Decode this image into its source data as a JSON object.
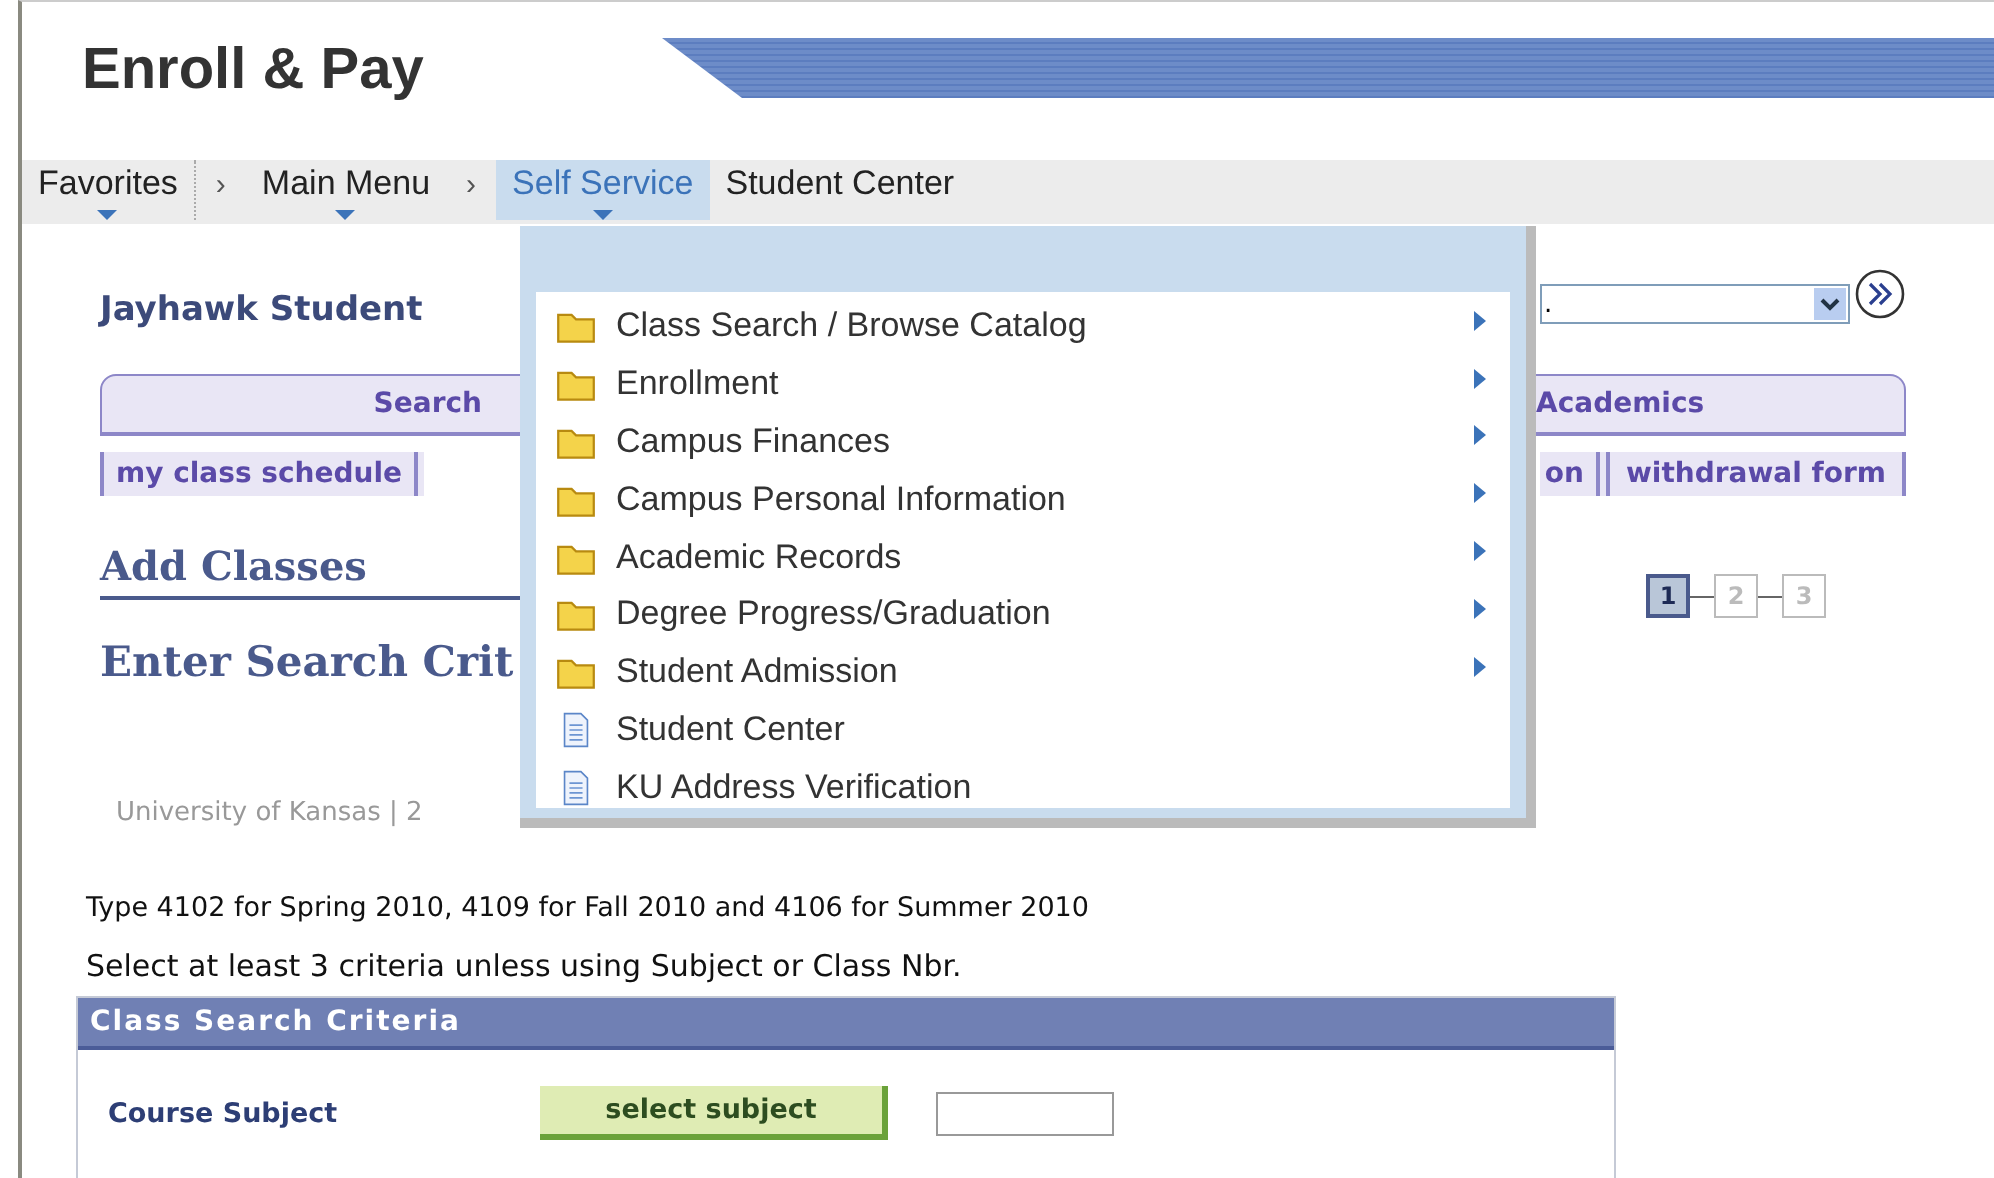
{
  "header": {
    "title": "Enroll & Pay"
  },
  "breadcrumbs": [
    {
      "label": "Favorites",
      "kind": "menu",
      "selected": false
    },
    {
      "label": "Main Menu",
      "kind": "menu",
      "selected": false,
      "separator": "›"
    },
    {
      "label": "Self Service",
      "kind": "menu",
      "selected": true,
      "separator": "›"
    },
    {
      "label": "Student Center",
      "kind": "page",
      "selected": false
    }
  ],
  "dropdown": [
    {
      "label": "Class Search / Browse Catalog",
      "kind": "folder",
      "submenu": true
    },
    {
      "label": "Enrollment",
      "kind": "folder",
      "submenu": true
    },
    {
      "label": "Campus Finances",
      "kind": "folder",
      "submenu": true
    },
    {
      "label": "Campus Personal Information",
      "kind": "folder",
      "submenu": true
    },
    {
      "label": "Academic Records",
      "kind": "folder",
      "submenu": true
    },
    {
      "label": "Degree Progress/Graduation",
      "kind": "folder",
      "submenu": true
    },
    {
      "label": "Student Admission",
      "kind": "folder",
      "submenu": true
    },
    {
      "label": "Student Center",
      "kind": "page",
      "submenu": false
    },
    {
      "label": "KU Address Verification",
      "kind": "page",
      "submenu": false
    }
  ],
  "student": {
    "name": "Jayhawk Student",
    "select_value": ".",
    "tabs": [
      {
        "label": "Search",
        "selected": false
      },
      {
        "label": "Academics",
        "selected": false
      }
    ],
    "links_left": [
      "my class schedule"
    ],
    "links_right": [
      "on",
      "withdrawal form"
    ]
  },
  "page": {
    "title": "Add Classes",
    "subtitle": "Enter Search Crit",
    "institution": "University of Kansas | 2",
    "steps": [
      {
        "label": "1",
        "selected": true
      },
      {
        "label": "2",
        "selected": false
      },
      {
        "label": "3",
        "selected": false
      }
    ],
    "notes": [
      "Type 4102 for Spring 2010, 4109 for Fall 2010 and 4106 for Summer 2010",
      "Select at least 3 criteria unless using Subject or Class Nbr."
    ]
  },
  "criteria": {
    "title": "Class Search Criteria",
    "field_label": "Course Subject",
    "button": "select subject"
  }
}
